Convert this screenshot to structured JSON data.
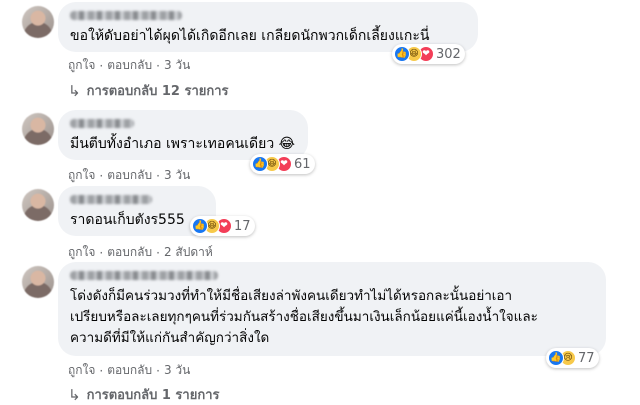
{
  "comments": [
    {
      "text": "ขอให้ดับอย่าได้ผุดได้เกิดอีกเลย เกลียดนักพวกเด็กเลี้ยงแกะนี่",
      "reactions": [
        "like-icon",
        "haha-icon",
        "love-icon"
      ],
      "reaction_count": "302",
      "like": "ถูกใจ",
      "reply": "ตอบกลับ",
      "time": "3 วัน",
      "replies_label": "การตอบกลับ 12 รายการ"
    },
    {
      "text": "มีนตีบทั้งอำเภอ เพราะเทอคนเดียว 😂",
      "reactions": [
        "like-icon",
        "haha-icon",
        "love-icon"
      ],
      "reaction_count": "61",
      "like": "ถูกใจ",
      "reply": "ตอบกลับ",
      "time": "3 วัน"
    },
    {
      "text": "ราดอนเก็บตังร555",
      "reactions": [
        "like-icon",
        "haha-icon",
        "love-icon"
      ],
      "reaction_count": "17",
      "like": "ถูกใจ",
      "reply": "ตอบกลับ",
      "time": "2 สัปดาห์"
    },
    {
      "text": "โด่งดังก็มีคนร่วมวงที่ทำให้มีชื่อเสียงล่าพังคนเดียวทำไม่ได้หรอกละนั้นอย่าเอา\nเปรียบหรือละเลยทุกๆคนที่ร่วมกันสร้างชื่อเสียงขึ้นมาเงินเล็กน้อยแค่นี้เองน้ำใจและ\nความดีที่มีให้แก่กันสำคัญกว่าสิ่งใด",
      "reactions": [
        "like-icon",
        "sad-icon"
      ],
      "reaction_count": "77",
      "like": "ถูกใจ",
      "reply": "ตอบกลับ",
      "time": "3 วัน",
      "replies_label": "การตอบกลับ 1 รายการ"
    }
  ],
  "separator": "·",
  "reply_arrow": "↳",
  "icon_glyphs": {
    "like-icon": "👍",
    "haha-icon": "😆",
    "love-icon": "❤",
    "sad-icon": "😢"
  }
}
